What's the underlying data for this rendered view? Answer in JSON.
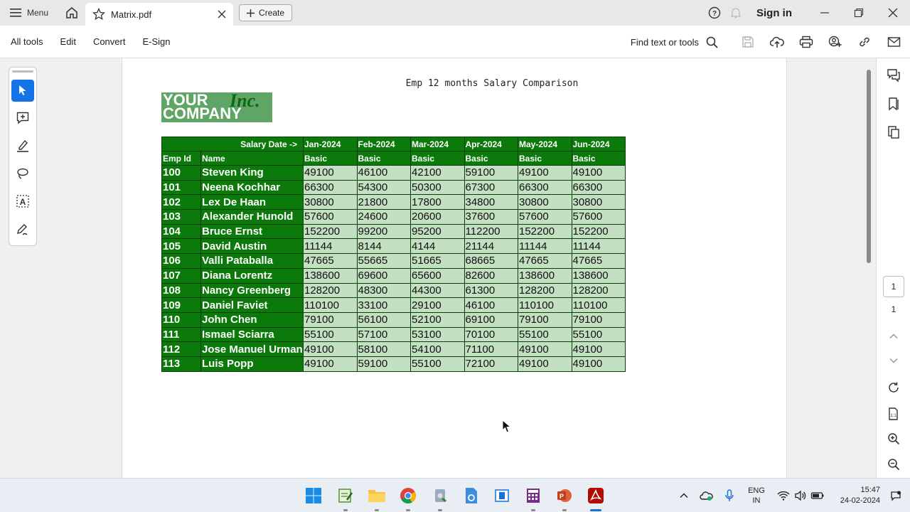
{
  "titlebar": {
    "menu_label": "Menu",
    "tab_title": "Matrix.pdf",
    "create_label": "Create",
    "sign_in": "Sign in"
  },
  "toolbar": {
    "items": [
      "All tools",
      "Edit",
      "Convert",
      "E-Sign"
    ],
    "find_label": "Find text or tools"
  },
  "document": {
    "title": "Emp 12 months Salary Comparison",
    "logo_line1": "YOUR",
    "logo_inc": "Inc.",
    "logo_line2": "COMPANY",
    "header_row1": {
      "label": "Salary Date ->",
      "months": [
        "Jan-2024",
        "Feb-2024",
        "Mar-2024",
        "Apr-2024",
        "May-2024",
        "Jun-2024"
      ]
    },
    "header_row2": {
      "emp_id": "Emp Id",
      "name": "Name",
      "sub": [
        "Basic",
        "Basic",
        "Basic",
        "Basic",
        "Basic",
        "Basic"
      ]
    },
    "rows": [
      {
        "id": "100",
        "name": "Steven King",
        "values": [
          "49100",
          "46100",
          "42100",
          "59100",
          "49100",
          "49100"
        ]
      },
      {
        "id": "101",
        "name": "Neena Kochhar",
        "values": [
          "66300",
          "54300",
          "50300",
          "67300",
          "66300",
          "66300"
        ]
      },
      {
        "id": "102",
        "name": "Lex De Haan",
        "values": [
          "30800",
          "21800",
          "17800",
          "34800",
          "30800",
          "30800"
        ]
      },
      {
        "id": "103",
        "name": "Alexander Hunold",
        "values": [
          "57600",
          "24600",
          "20600",
          "37600",
          "57600",
          "57600"
        ]
      },
      {
        "id": "104",
        "name": "Bruce Ernst",
        "values": [
          "152200",
          "99200",
          "95200",
          "112200",
          "152200",
          "152200"
        ]
      },
      {
        "id": "105",
        "name": "David Austin",
        "values": [
          "11144",
          "8144",
          "4144",
          "21144",
          "11144",
          "11144"
        ]
      },
      {
        "id": "106",
        "name": "Valli Pataballa",
        "values": [
          "47665",
          "55665",
          "51665",
          "68665",
          "47665",
          "47665"
        ]
      },
      {
        "id": "107",
        "name": "Diana Lorentz",
        "values": [
          "138600",
          "69600",
          "65600",
          "82600",
          "138600",
          "138600"
        ]
      },
      {
        "id": "108",
        "name": "Nancy Greenberg",
        "values": [
          "128200",
          "48300",
          "44300",
          "61300",
          "128200",
          "128200"
        ]
      },
      {
        "id": "109",
        "name": "Daniel Faviet",
        "values": [
          "110100",
          "33100",
          "29100",
          "46100",
          "110100",
          "110100"
        ]
      },
      {
        "id": "110",
        "name": "John Chen",
        "values": [
          "79100",
          "56100",
          "52100",
          "69100",
          "79100",
          "79100"
        ]
      },
      {
        "id": "111",
        "name": "Ismael Sciarra",
        "values": [
          "55100",
          "57100",
          "53100",
          "70100",
          "55100",
          "55100"
        ]
      },
      {
        "id": "112",
        "name": "Jose Manuel Urman",
        "values": [
          "49100",
          "58100",
          "54100",
          "71100",
          "49100",
          "49100"
        ]
      },
      {
        "id": "113",
        "name": "Luis Popp",
        "values": [
          "49100",
          "59100",
          "55100",
          "72100",
          "49100",
          "49100"
        ]
      }
    ]
  },
  "right_panel": {
    "page_current": "1",
    "page_total": "1"
  },
  "taskbar": {
    "lang_line1": "ENG",
    "lang_line2": "IN",
    "time": "15:47",
    "date": "24-02-2024"
  },
  "colors": {
    "header_green": "#0b7a0b",
    "cell_green": "#c3e0c3",
    "accent_blue": "#1473e6"
  }
}
